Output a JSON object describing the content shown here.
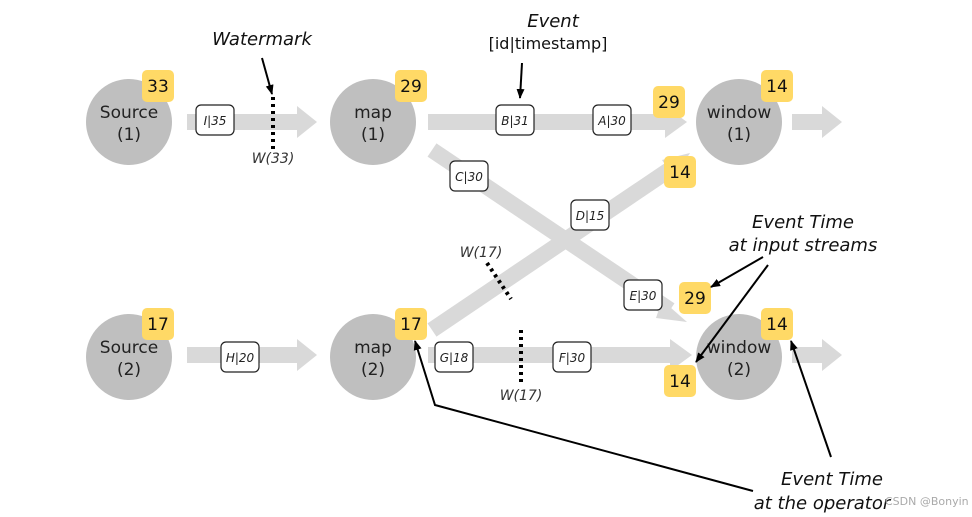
{
  "nodes": [
    {
      "name": "Source",
      "index": "(1)",
      "badge": "33"
    },
    {
      "name": "map",
      "index": "(1)",
      "badge": "29"
    },
    {
      "name": "window",
      "index": "(1)",
      "badge": "14"
    },
    {
      "name": "Source",
      "index": "(2)",
      "badge": "17"
    },
    {
      "name": "map",
      "index": "(2)",
      "badge": "17"
    },
    {
      "name": "window",
      "index": "(2)",
      "badge": "14"
    }
  ],
  "input_badges": {
    "window1_top": "29",
    "window1_bottom": "14",
    "window2_top": "29",
    "window2_bottom": "14"
  },
  "events": {
    "i": "I|35",
    "b": "B|31",
    "a": "A|30",
    "c": "C|30",
    "d": "D|15",
    "e": "E|30",
    "h": "H|20",
    "g": "G|18",
    "f": "F|30"
  },
  "watermarks": {
    "w1": "W(33)",
    "w2": "W(17)",
    "w3": "W(17)"
  },
  "annotations": {
    "watermark": "Watermark",
    "event": "Event",
    "event_format": "[id|timestamp]",
    "input_time_1": "Event Time",
    "input_time_2": "at input streams",
    "operator_time_1": "Event Time",
    "operator_time_2": "at the operator"
  },
  "credit": "CSDN @Bonyin",
  "colors": {
    "node": "#bfbfbf",
    "badge": "#ffd966",
    "stream": "#d9d9d9"
  }
}
